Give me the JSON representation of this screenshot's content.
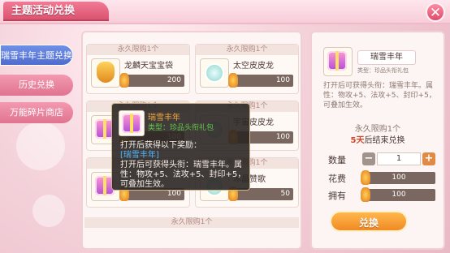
{
  "window": {
    "title": "主题活动兑换"
  },
  "sidebar": {
    "items": [
      {
        "label": "瑞雪丰年主题兑换",
        "active": true
      },
      {
        "label": "历史兑换",
        "active": false
      },
      {
        "label": "万能碎片商店",
        "active": false
      }
    ]
  },
  "items": {
    "limit_caption": "永久限购1个",
    "cards": [
      {
        "name": "龙麟天宝宝袋",
        "price": "200",
        "icon": "treasure-bag-icon"
      },
      {
        "name": "太空皮皮龙",
        "price": "100",
        "icon": "space-dragon-icon"
      },
      {
        "name": "宇宙皮皮龙",
        "price": "100",
        "icon": "cosmic-dragon-icon"
      },
      {
        "name": "",
        "price": "100",
        "icon": "gift-box-icon"
      },
      {
        "name": "冰晶赞歌",
        "price": "50",
        "icon": "ice-crystal-icon"
      },
      {
        "name": "",
        "price": "100",
        "icon": "gift-box-icon"
      }
    ]
  },
  "tooltip": {
    "name": "瑞雪丰年",
    "type": "类型：珍品头衔礼包",
    "line1": "打开后获得以下奖励：",
    "line2": "[瑞雪丰年]",
    "line3": "打开后可获得头衔：瑞雪丰年。属性：物攻+5、法攻+5、封印+5，可叠加生效。"
  },
  "detail": {
    "name": "瑞雪丰年",
    "type": "类型：珍品头衔礼包",
    "desc": "打开后可获得头衔：瑞雪丰年。属性：物攻+5、法攻+5、封印+5，可叠加生效。",
    "limit": "永久限购1个",
    "ends_days": "5天",
    "ends_suffix": "后结束兑换",
    "qty_label": "数量",
    "qty_value": "1",
    "cost_label": "花费",
    "cost_value": "100",
    "own_label": "拥有",
    "own_value": "100",
    "exchange_label": "兑换"
  },
  "colors": {
    "accent": "#e04a6c",
    "active_tab": "#4e6cd0",
    "button": "#f08a24"
  }
}
